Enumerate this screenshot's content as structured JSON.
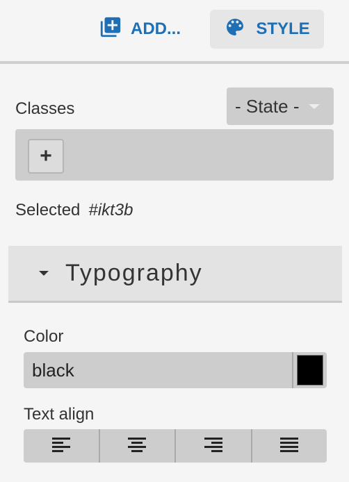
{
  "toolbar": {
    "add_label": "ADD...",
    "style_label": "STYLE",
    "add_icon": "add-box-icon",
    "style_icon": "palette-icon"
  },
  "selector": {
    "classes_label": "Classes",
    "state_select": "- State -",
    "add_class_symbol": "+",
    "selected_label": "Selected",
    "selected_id": "#ikt3b"
  },
  "typography": {
    "title": "Typography",
    "color_label": "Color",
    "color_value": "black",
    "swatch_color": "#000000",
    "text_align_label": "Text align",
    "align_options": [
      {
        "icon": "align-left-icon"
      },
      {
        "icon": "align-center-icon"
      },
      {
        "icon": "align-right-icon"
      },
      {
        "icon": "align-justify-icon"
      }
    ]
  },
  "colors": {
    "accent": "#1f6fb5",
    "panel": "#cdcdcd",
    "background": "#f5f5f5"
  }
}
